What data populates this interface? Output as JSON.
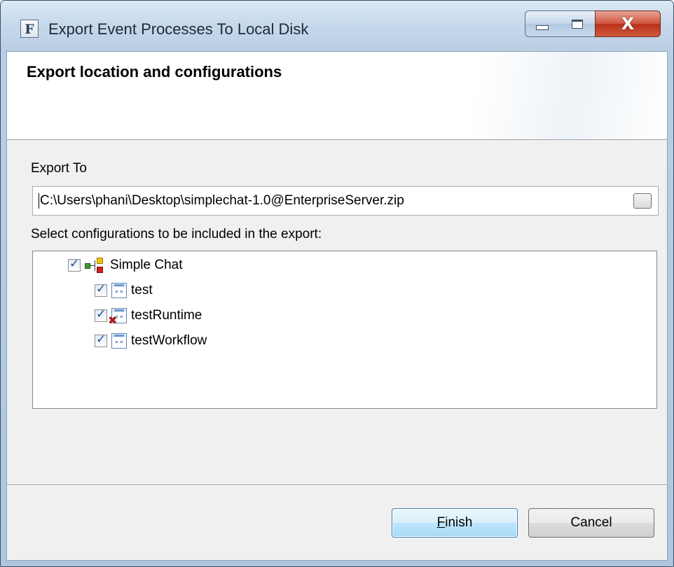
{
  "window": {
    "title": "Export Event Processes To Local Disk",
    "icon_letter": "F",
    "minimize_glyph": "minimize-icon",
    "maximize_glyph": "maximize-icon",
    "close_glyph": "X"
  },
  "banner": {
    "title": "Export location and configurations"
  },
  "export": {
    "label": "Export To",
    "path_value": "C:\\Users\\phani\\Desktop\\simplechat-1.0@EnterpriseServer.zip",
    "configs_label": "Select configurations to be included in the export:"
  },
  "tree": {
    "root": {
      "label": "Simple Chat",
      "checked": true,
      "icon": "project-icon"
    },
    "children": [
      {
        "label": "test",
        "checked": true,
        "icon": "configuration-icon",
        "error": false
      },
      {
        "label": "testRuntime",
        "checked": true,
        "icon": "configuration-icon",
        "error": true
      },
      {
        "label": "testWorkflow",
        "checked": true,
        "icon": "configuration-icon",
        "error": false
      }
    ]
  },
  "buttons": {
    "finish_mnemonic": "F",
    "finish_rest": "inish",
    "cancel_label": "Cancel"
  },
  "colors": {
    "title_bar": "#c7d9ec",
    "close_button": "#c7432b",
    "default_button": "#bee6fd",
    "dialog_bg": "#f0f0f0"
  }
}
